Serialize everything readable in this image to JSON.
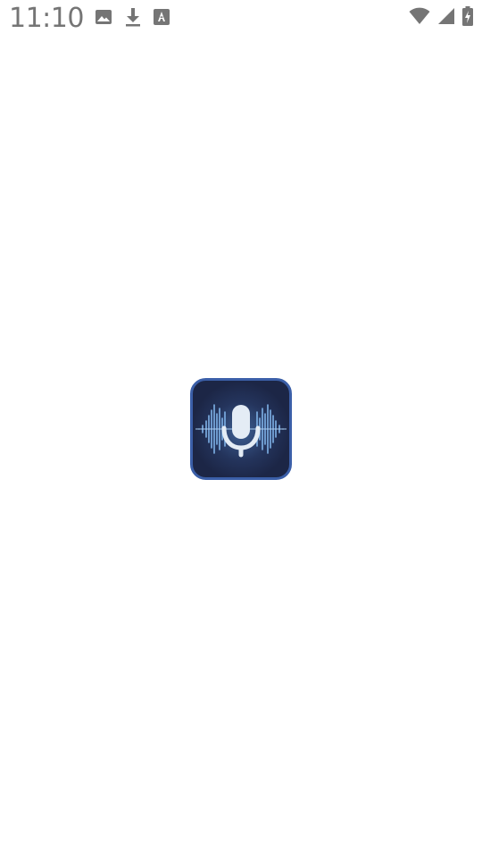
{
  "status_bar": {
    "time": "11:10",
    "left_icons": [
      "image-icon",
      "download-icon",
      "font-download-icon"
    ],
    "right_icons": [
      "wifi-icon",
      "cellular-signal-icon",
      "battery-charging-icon"
    ],
    "icon_color": "#757575"
  },
  "splash": {
    "logo_icon": "voice-recorder-app-icon",
    "logo_background_color": "#1f2b4f",
    "logo_border_color": "#3b5fa8",
    "wave_color": "#7fb2e8",
    "mic_color": "#e4ecf5"
  }
}
